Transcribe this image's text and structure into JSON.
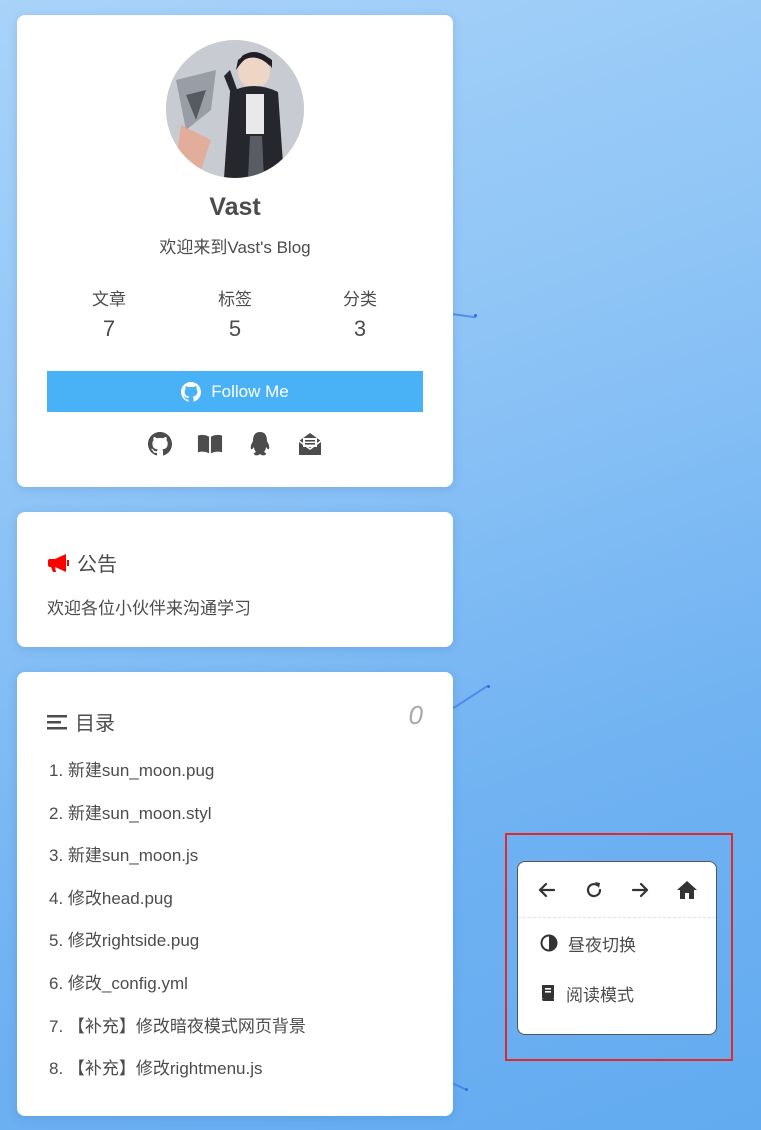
{
  "profile": {
    "author_name": "Vast",
    "description": "欢迎来到Vast's Blog",
    "stats": [
      {
        "label": "文章",
        "value": "7"
      },
      {
        "label": "标签",
        "value": "5"
      },
      {
        "label": "分类",
        "value": "3"
      }
    ],
    "follow_label": "Follow Me",
    "social_icons": [
      "github-icon",
      "book-icon",
      "qq-icon",
      "mail-icon"
    ]
  },
  "announcement": {
    "title": "公告",
    "icon": "bullhorn-icon",
    "text": "欢迎各位小伙伴来沟通学习"
  },
  "toc": {
    "title": "目录",
    "icon": "list-icon",
    "percentage": "0",
    "items": [
      "1. 新建sun_moon.pug",
      "2. 新建sun_moon.styl",
      "3. 新建sun_moon.js",
      "4. 修改head.pug",
      "5. 修改rightside.pug",
      "6. 修改_config.yml",
      "7. 【补充】修改暗夜模式网页背景",
      "8. 【补充】修改rightmenu.js"
    ]
  },
  "right_menu": {
    "nav_icons": [
      "arrow-left-icon",
      "refresh-icon",
      "arrow-right-icon",
      "home-icon"
    ],
    "items": [
      {
        "label": "昼夜切换",
        "icon": "half-circle-icon"
      },
      {
        "label": "阅读模式",
        "icon": "book-icon"
      }
    ]
  },
  "colors": {
    "accent": "#49b1f5",
    "announce_icon": "#ff0000",
    "highlight": "#e02a2a"
  }
}
